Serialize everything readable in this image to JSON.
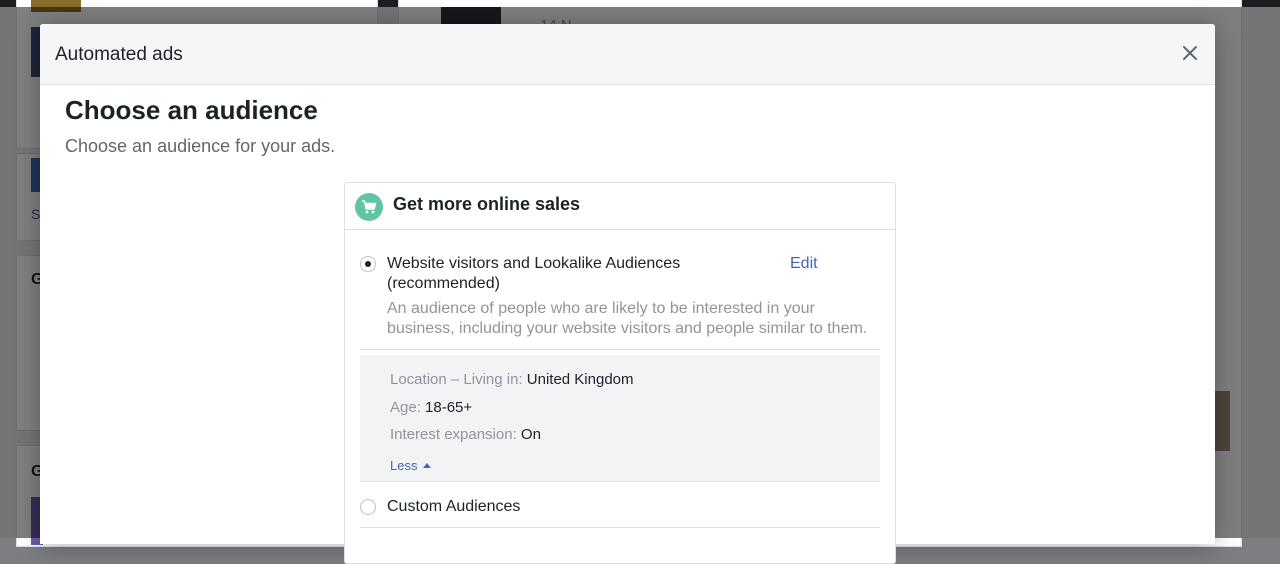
{
  "modal": {
    "title": "Automated ads",
    "heading": "Choose an audience",
    "subheading": "Choose an audience for your ads."
  },
  "panel": {
    "title": "Get more online sales",
    "icon": "cart-icon",
    "accent_color": "#5fc5a5",
    "options": [
      {
        "label_line1": "Website visitors and Lookalike Audiences",
        "label_line2": "(recommended)",
        "edit_label": "Edit",
        "selected": true,
        "description_line1": "An audience of people who are likely to be interested in your",
        "description_line2": "business, including your website visitors and people similar to them."
      },
      {
        "label": "Custom Audiences",
        "selected": false
      }
    ],
    "details": {
      "location_label": "Location – Living in:",
      "location_value": "United Kingdom",
      "age_label": "Age:",
      "age_value": "18-65+",
      "interest_label": "Interest expansion:",
      "interest_value": "On",
      "less_label": "Less"
    }
  },
  "background": {
    "left_heading_1": "G",
    "left_heading_2": "G",
    "left_link": "S",
    "partial_text": "14 N"
  }
}
